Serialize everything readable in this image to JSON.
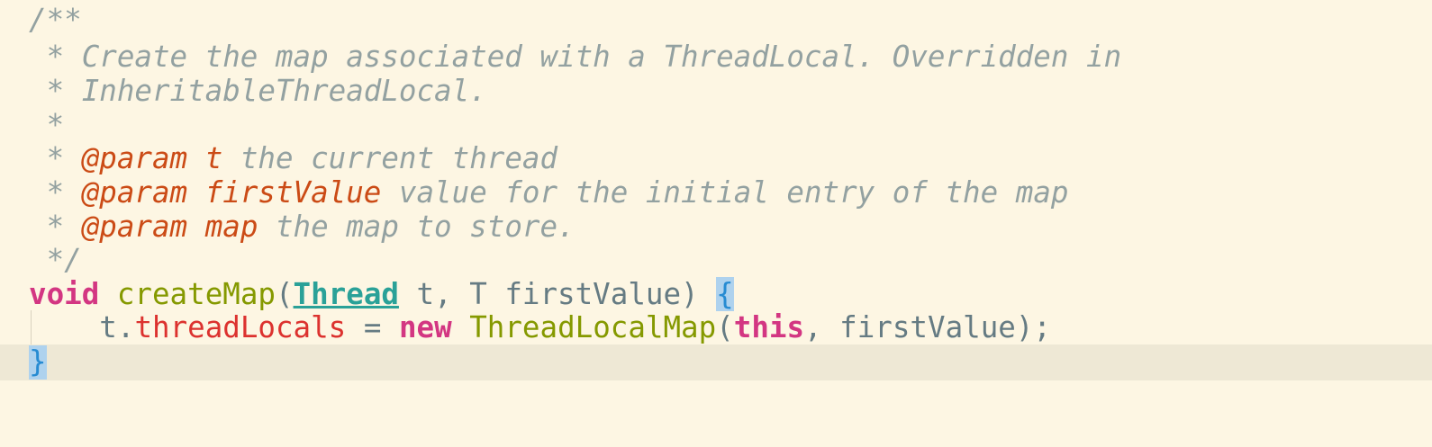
{
  "editor": {
    "line1": "/**",
    "line2": " * Create the map associated with a ThreadLocal. Overridden in",
    "line3": " * InheritableThreadLocal.",
    "line4": " *",
    "line5": {
      "prefix": " * ",
      "tag": "@param",
      "space": " ",
      "name": "t",
      "desc": " the current thread"
    },
    "line6": {
      "prefix": " * ",
      "tag": "@param",
      "space": " ",
      "name": "firstValue",
      "desc": " value for the initial entry of the map"
    },
    "line7": {
      "prefix": " * ",
      "tag": "@param",
      "space": " ",
      "name": "map",
      "desc": " the map to store."
    },
    "line8": " */",
    "line9": {
      "kw": "void",
      "sp1": " ",
      "fn": "createMap",
      "p1": "(",
      "type": "Thread",
      "p2": " t, T firstValue) ",
      "brace": "{"
    },
    "line10": {
      "indent": "    ",
      "obj": "t",
      "dot": ".",
      "field": "threadLocals",
      "eq": " = ",
      "kw": "new",
      "sp": " ",
      "cls": "ThreadLocalMap",
      "open": "(",
      "this": "this",
      "rest": ", firstValue);"
    },
    "line11": "}"
  },
  "colors": {
    "background": "#FDF6E3",
    "current_line": "#EEE8D5",
    "comment": "#93A1A1",
    "doc_tag": "#CB4B16",
    "keyword": "#D33682",
    "function": "#859900",
    "type_link": "#2AA198",
    "field": "#DC322F",
    "brace_highlight": "#AED2EE"
  }
}
